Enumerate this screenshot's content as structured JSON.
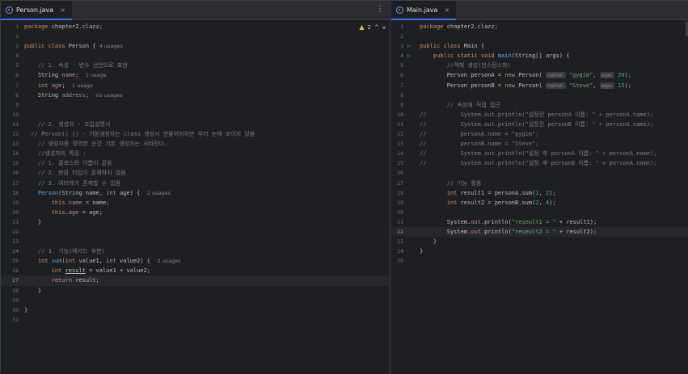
{
  "left": {
    "tab": {
      "label": "Person.java",
      "close": "×"
    },
    "menu": "⋮",
    "problems": {
      "count": "2",
      "up": "^",
      "down": "v"
    },
    "lines": [
      {
        "n": "1",
        "parts": [
          [
            "kw",
            "package "
          ],
          [
            "",
            "chapter2.clazz;"
          ]
        ]
      },
      {
        "n": "2",
        "parts": []
      },
      {
        "n": "3",
        "parts": [
          [
            "kw",
            "public class "
          ],
          [
            "",
            "Person { "
          ],
          [
            "hint",
            "4 usages"
          ]
        ]
      },
      {
        "n": "4",
        "parts": []
      },
      {
        "n": "5",
        "parts": [
          [
            "cm",
            "    // 1. 속성 - 변수 선언으로 표현"
          ]
        ]
      },
      {
        "n": "6",
        "parts": [
          [
            "",
            "    String "
          ],
          [
            "fd",
            "name"
          ],
          [
            "",
            ";  "
          ],
          [
            "hint",
            "1 usage"
          ]
        ]
      },
      {
        "n": "7",
        "parts": [
          [
            "kw",
            "    int "
          ],
          [
            "fd",
            "age"
          ],
          [
            "",
            ";  "
          ],
          [
            "hint",
            "1 usage"
          ]
        ]
      },
      {
        "n": "8",
        "parts": [
          [
            "",
            "    String "
          ],
          [
            "mut",
            "address"
          ],
          [
            "",
            ";  "
          ],
          [
            "hint",
            "no usages"
          ]
        ]
      },
      {
        "n": "9",
        "parts": []
      },
      {
        "n": "10",
        "parts": []
      },
      {
        "n": "11",
        "parts": [
          [
            "cm",
            "    // 2. 생성자 - 조립설명서"
          ]
        ]
      },
      {
        "n": "12",
        "parts": [
          [
            "cm",
            "  // Person() {} - 기본생성자는 class 생성시 만들어지지만 우리 눈에 보이지 않음"
          ]
        ]
      },
      {
        "n": "13",
        "parts": [
          [
            "cm",
            "    // 생성자를 정의한 순간 기본 생성자는 사라진다."
          ]
        ]
      },
      {
        "n": "14",
        "parts": [
          [
            "cm",
            "    //생성자의 특징 :"
          ]
        ]
      },
      {
        "n": "15",
        "parts": [
          [
            "cm",
            "    // 1. 클래스와 이름이 같음"
          ]
        ]
      },
      {
        "n": "16",
        "parts": [
          [
            "cm",
            "    // 2. 반환 타입이 존재하지 않음"
          ]
        ]
      },
      {
        "n": "17",
        "parts": [
          [
            "cm",
            "    // 3. 여러개가 존재할 수 있음"
          ]
        ]
      },
      {
        "n": "18",
        "parts": [
          [
            "fn",
            "    Person"
          ],
          [
            "",
            "(String name, "
          ],
          [
            "kw",
            "int "
          ],
          [
            "",
            "age) {  "
          ],
          [
            "hint",
            "2 usages"
          ]
        ]
      },
      {
        "n": "19",
        "parts": [
          [
            "kw",
            "        this"
          ],
          [
            "",
            "."
          ],
          [
            "fd",
            "name"
          ],
          [
            "",
            " = name;"
          ]
        ]
      },
      {
        "n": "20",
        "parts": [
          [
            "kw",
            "        this"
          ],
          [
            "",
            "."
          ],
          [
            "fd",
            "age"
          ],
          [
            "",
            " = age;"
          ]
        ]
      },
      {
        "n": "21",
        "parts": [
          [
            "",
            "    }"
          ]
        ]
      },
      {
        "n": "22",
        "parts": []
      },
      {
        "n": "23",
        "parts": []
      },
      {
        "n": "24",
        "parts": [
          [
            "cm",
            "    // 3. 기능(메서드 부분)"
          ]
        ]
      },
      {
        "n": "25",
        "parts": [
          [
            "kw",
            "    int "
          ],
          [
            "fn",
            "sum"
          ],
          [
            "",
            "("
          ],
          [
            "kw",
            "int "
          ],
          [
            "",
            "value1, "
          ],
          [
            "kw",
            "int "
          ],
          [
            "",
            "value2) {  "
          ],
          [
            "hint",
            "2 usages"
          ]
        ]
      },
      {
        "n": "26",
        "parts": [
          [
            "kw",
            "        int "
          ],
          [
            "und",
            "result"
          ],
          [
            "",
            " = value1 + value2;"
          ]
        ]
      },
      {
        "n": "27",
        "parts": [
          [
            "kw",
            "        return "
          ],
          [
            "",
            "result;"
          ]
        ],
        "cur": true
      },
      {
        "n": "28",
        "parts": [
          [
            "",
            "    }"
          ]
        ]
      },
      {
        "n": "29",
        "parts": []
      },
      {
        "n": "30",
        "parts": [
          [
            "",
            "}"
          ]
        ]
      },
      {
        "n": "31",
        "parts": []
      }
    ]
  },
  "right": {
    "tab": {
      "label": "Main.java",
      "close": "×"
    },
    "lines": [
      {
        "n": "1",
        "parts": [
          [
            "kw",
            "package "
          ],
          [
            "",
            "chapter2.clazz;"
          ]
        ]
      },
      {
        "n": "2",
        "parts": []
      },
      {
        "n": "3",
        "run": true,
        "parts": [
          [
            "kw",
            "public class "
          ],
          [
            "",
            "Main {"
          ]
        ]
      },
      {
        "n": "4",
        "run": true,
        "parts": [
          [
            "kw",
            "    public static void "
          ],
          [
            "fn",
            "main"
          ],
          [
            "",
            "(String[] args) {"
          ]
        ]
      },
      {
        "n": "5",
        "parts": [
          [
            "cm",
            "        //객체 생성(인스턴스화)"
          ]
        ]
      },
      {
        "n": "6",
        "parts": [
          [
            "",
            "        Person personA = "
          ],
          [
            "kw",
            "new "
          ],
          [
            "",
            "Person( "
          ],
          [
            "ph",
            "name:"
          ],
          [
            "",
            " "
          ],
          [
            "str",
            "\"gygim\""
          ],
          [
            "",
            ", "
          ],
          [
            "ph",
            "age:"
          ],
          [
            "",
            " "
          ],
          [
            "num",
            "20"
          ],
          [
            "",
            ");"
          ]
        ]
      },
      {
        "n": "7",
        "parts": [
          [
            "",
            "        Person personB = "
          ],
          [
            "kw",
            "new "
          ],
          [
            "",
            "Person( "
          ],
          [
            "ph",
            "name:"
          ],
          [
            "",
            " "
          ],
          [
            "str",
            "\"Steve\""
          ],
          [
            "",
            ", "
          ],
          [
            "ph",
            "age:"
          ],
          [
            "",
            " "
          ],
          [
            "num",
            "15"
          ],
          [
            "",
            ");"
          ]
        ]
      },
      {
        "n": "8",
        "parts": []
      },
      {
        "n": "9",
        "parts": [
          [
            "cm",
            "        // 속성에 직접 접근"
          ]
        ]
      },
      {
        "n": "10",
        "parts": [
          [
            "cm",
            "//          System.out.println(\"설정전 personA 이름: \" + personA.name);"
          ]
        ]
      },
      {
        "n": "11",
        "parts": [
          [
            "cm",
            "//          System.out.println(\"설정전 personB 이름: \" + personA.name);"
          ]
        ]
      },
      {
        "n": "12",
        "parts": [
          [
            "cm",
            "//          personA.name = \"gygim\";"
          ]
        ]
      },
      {
        "n": "13",
        "parts": [
          [
            "cm",
            "//          personB.name = \"Steve\";"
          ]
        ]
      },
      {
        "n": "14",
        "parts": [
          [
            "cm",
            "//          System.out.println(\"설정 후 personA 이름: \" + personA.name);"
          ]
        ]
      },
      {
        "n": "15",
        "parts": [
          [
            "cm",
            "//          System.out.println(\"설정 후 personB 이름: \" + personA.name);"
          ]
        ]
      },
      {
        "n": "16",
        "parts": []
      },
      {
        "n": "17",
        "parts": [
          [
            "cm",
            "        // 기능 활용"
          ]
        ]
      },
      {
        "n": "18",
        "parts": [
          [
            "kw",
            "        int "
          ],
          [
            "",
            "result1 = personA.sum("
          ],
          [
            "num",
            "1"
          ],
          [
            "",
            ", "
          ],
          [
            "num",
            "2"
          ],
          [
            "",
            ");"
          ]
        ]
      },
      {
        "n": "19",
        "parts": [
          [
            "kw",
            "        int "
          ],
          [
            "",
            "result2 = personB.sum("
          ],
          [
            "num",
            "2"
          ],
          [
            "",
            ", "
          ],
          [
            "num",
            "4"
          ],
          [
            "",
            ");"
          ]
        ]
      },
      {
        "n": "20",
        "parts": []
      },
      {
        "n": "21",
        "parts": [
          [
            "",
            "        System."
          ],
          [
            "fd",
            "out"
          ],
          [
            "",
            ".println("
          ],
          [
            "str",
            "\"reseult1 = \""
          ],
          [
            "",
            " + result1);"
          ]
        ]
      },
      {
        "n": "22",
        "parts": [
          [
            "",
            "        System."
          ],
          [
            "fd",
            "out"
          ],
          [
            "",
            ".println("
          ],
          [
            "str",
            "\"reseult2 = \""
          ],
          [
            "",
            " + result2);"
          ]
        ],
        "cur": true
      },
      {
        "n": "23",
        "parts": [
          [
            "",
            "    }"
          ]
        ]
      },
      {
        "n": "24",
        "parts": [
          [
            "",
            "}"
          ]
        ]
      },
      {
        "n": "25",
        "parts": []
      }
    ]
  }
}
